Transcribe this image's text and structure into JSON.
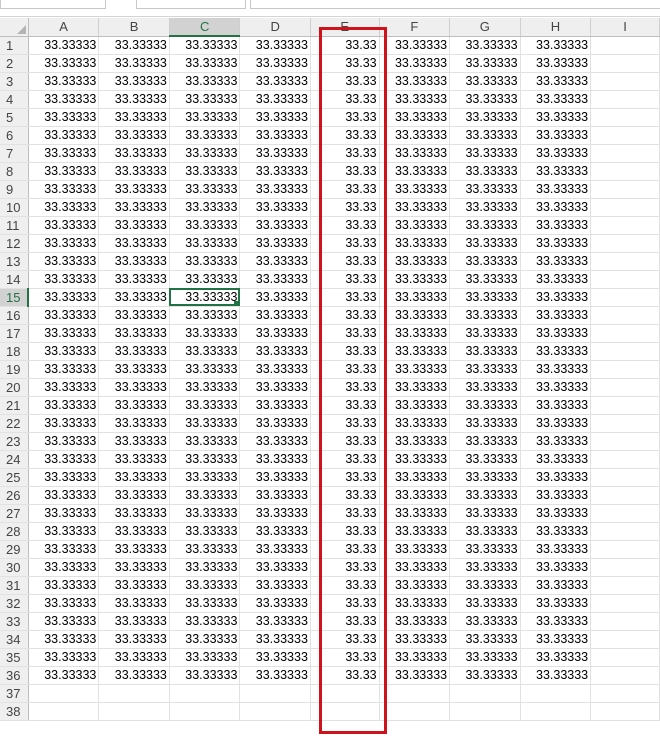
{
  "columns": [
    "A",
    "B",
    "C",
    "D",
    "E",
    "F",
    "G",
    "H",
    "I"
  ],
  "selected_column": "C",
  "selected_row": 15,
  "active_cell": "C15",
  "highlighted_column": "E",
  "highlight_color": "#d0121b",
  "accent_color": "#217346",
  "row_count_filled": 36,
  "row_count_visible": 38,
  "cell_value_default": "33.33333",
  "cell_value_column_E": "33.33",
  "row_labels": [
    "1",
    "2",
    "3",
    "4",
    "5",
    "6",
    "7",
    "8",
    "9",
    "10",
    "11",
    "12",
    "13",
    "14",
    "15",
    "16",
    "17",
    "18",
    "19",
    "20",
    "21",
    "22",
    "23",
    "24",
    "25",
    "26",
    "27",
    "28",
    "29",
    "30",
    "31",
    "32",
    "33",
    "34",
    "35",
    "36",
    "37",
    "38"
  ]
}
